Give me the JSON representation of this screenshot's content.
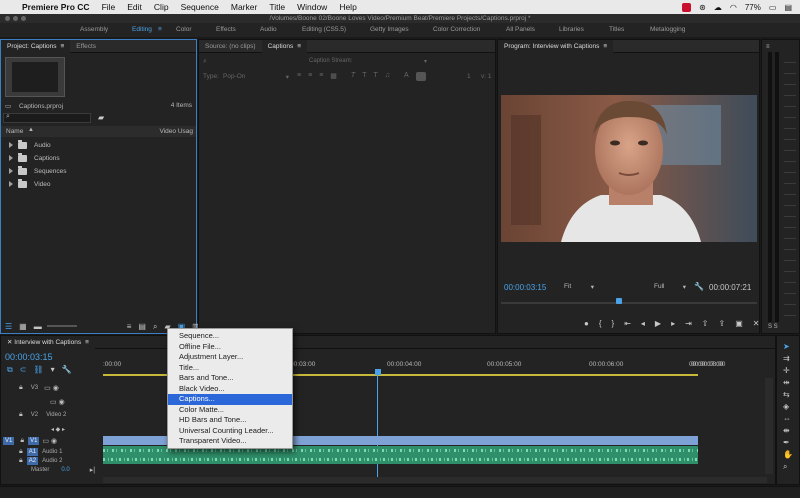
{
  "menubar": {
    "app_name": "Premiere Pro CC",
    "items": [
      "File",
      "Edit",
      "Clip",
      "Sequence",
      "Marker",
      "Title",
      "Window",
      "Help"
    ],
    "battery": "77%"
  },
  "window": {
    "title": "/Volumes/Boone 02/Boone Loves Video/Premium Beat/Premiere Projects/Captions.prproj *"
  },
  "workspaces": [
    "Assembly",
    "Editing",
    "Color",
    "Effects",
    "Audio",
    "Editing (CS5.5)",
    "Getty Images",
    "Color Correction",
    "All Panels",
    "Libraries",
    "Titles",
    "Metalogging"
  ],
  "project": {
    "tabs": [
      "Project: Captions",
      "Effects"
    ],
    "file_name": "Captions.prproj",
    "item_count": "4 Items",
    "col_name": "Name",
    "col_usage": "Video Usag",
    "bins": [
      "Audio",
      "Captions",
      "Sequences",
      "Video"
    ]
  },
  "captions_panel": {
    "tabs": [
      "Source: (no clips)",
      "Captions"
    ],
    "stream_label": "Caption Stream:",
    "type_label": "Type:",
    "type_value": "Pop-On",
    "field_1": "1",
    "field_v": "v: 1"
  },
  "program": {
    "tab": "Program: Interview with Captions",
    "timecode_current": "00:00:03:15",
    "fit_value": "Fit",
    "quality_value": "Full",
    "timecode_duration": "00:00:07:21"
  },
  "timeline": {
    "tab": "Interview with Captions",
    "timecode": "00:00:03:15",
    "ruler": [
      ":00:00",
      "00:00:03:00",
      "00:00:04:00",
      "00:00:05:00",
      "00:00:06:00",
      "00:00:07:00",
      "00:00:08:00"
    ],
    "tracks": {
      "v3": "V3",
      "v2": "V2",
      "v2_name": "Video 2",
      "v1_src": "V1",
      "v1": "V1",
      "a1": "A1",
      "a1_name": "Audio 1",
      "a2": "A2",
      "a2_name": "Audio 2",
      "master": "Master",
      "master_val": "0.0"
    }
  },
  "context_menu": {
    "items": [
      "Sequence...",
      "Offline File...",
      "Adjustment Layer...",
      "Title...",
      "Bars and Tone...",
      "Black Video...",
      "Captions...",
      "Color Matte...",
      "HD Bars and Tone...",
      "Universal Counting Leader...",
      "Transparent Video..."
    ],
    "highlighted_index": 6
  },
  "colors": {
    "accent_blue": "#4aa3e8",
    "timecode_blue": "#4aa3e8",
    "clip_blue": "#7fa2d6",
    "audio_green": "#2f8f6a",
    "highlight": "#2b67d9"
  }
}
